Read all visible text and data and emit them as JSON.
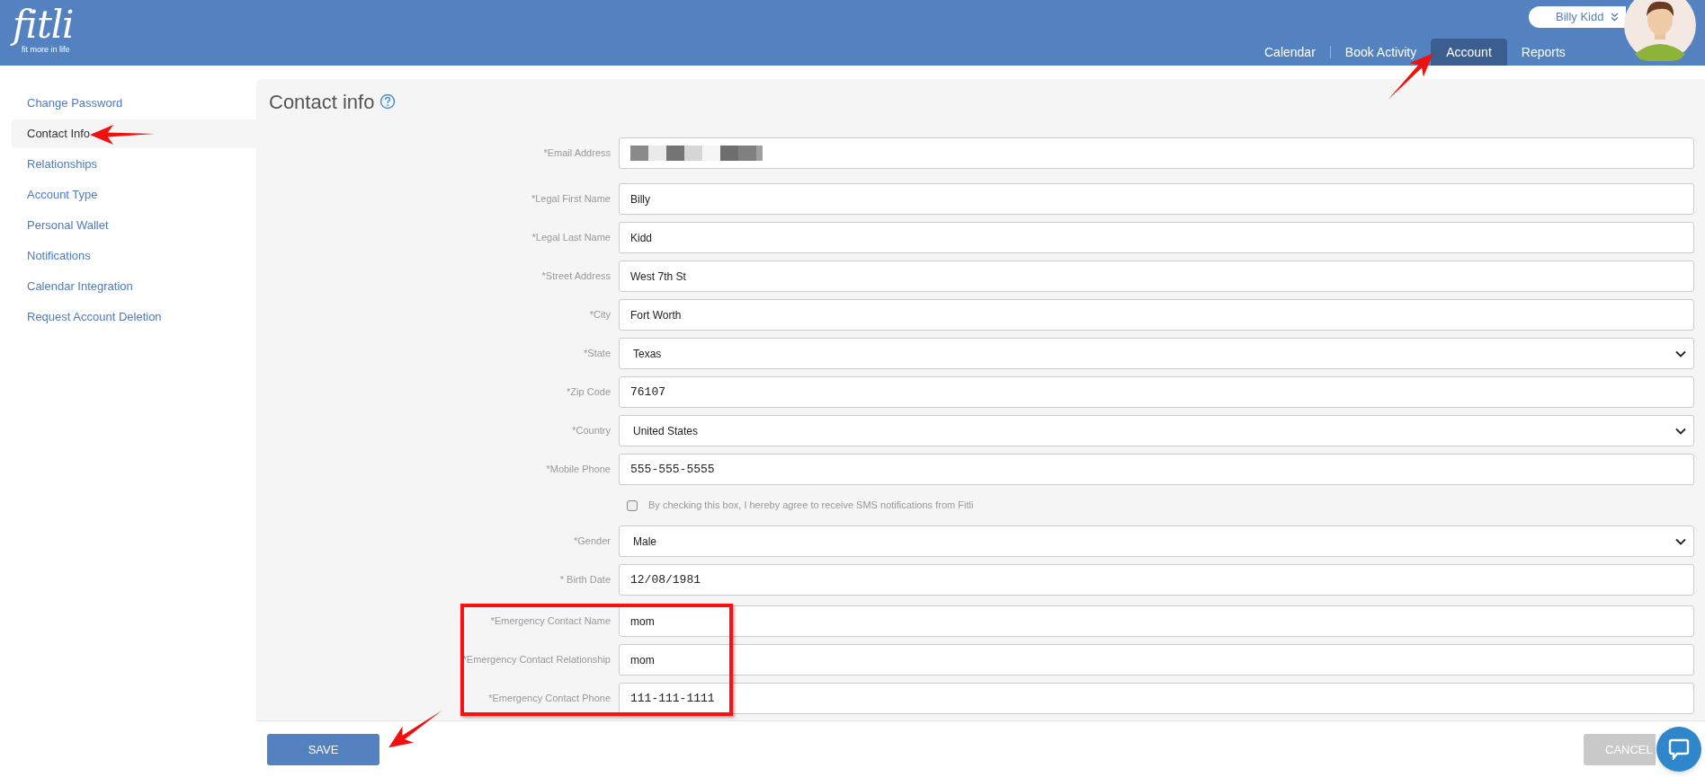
{
  "header": {
    "logo": "fitli",
    "tagline": "fit more in life",
    "user": {
      "name": "Billy Kidd"
    },
    "nav": [
      {
        "label": "Calendar",
        "selected": false
      },
      {
        "label": "Book Activity",
        "selected": false
      },
      {
        "label": "Account",
        "selected": true
      },
      {
        "label": "Reports",
        "selected": false
      }
    ]
  },
  "sidebar": {
    "items": [
      {
        "label": "Change Password",
        "selected": false
      },
      {
        "label": "Contact Info",
        "selected": true
      },
      {
        "label": "Relationships",
        "selected": false
      },
      {
        "label": "Account Type",
        "selected": false
      },
      {
        "label": "Personal Wallet",
        "selected": false
      },
      {
        "label": "Notifications",
        "selected": false
      },
      {
        "label": "Calendar Integration",
        "selected": false
      },
      {
        "label": "Request Account Deletion",
        "selected": false
      }
    ]
  },
  "form": {
    "title": "Contact info",
    "fields": [
      {
        "kind": "redacted",
        "label": "*Email Address"
      },
      {
        "kind": "text",
        "label": "*Legal First Name",
        "value": "Billy"
      },
      {
        "kind": "text",
        "label": "*Legal Last Name",
        "value": "Kidd"
      },
      {
        "kind": "text",
        "label": "*Street Address",
        "value": "West 7th St"
      },
      {
        "kind": "text",
        "label": "*City",
        "value": "Fort Worth"
      },
      {
        "kind": "select",
        "label": "*State",
        "value": "Texas"
      },
      {
        "kind": "numeric",
        "label": "*Zip Code",
        "value": "76107"
      },
      {
        "kind": "select",
        "label": "*Country",
        "value": "United States"
      },
      {
        "kind": "numeric",
        "label": "*Mobile Phone",
        "value": "555-555-5555"
      },
      {
        "kind": "checkbox",
        "label": "By checking this box, I hereby agree to receive SMS notifications from Fitli",
        "checked": false
      },
      {
        "kind": "select",
        "label": "*Gender",
        "value": "Male"
      },
      {
        "kind": "numeric",
        "label": "* Birth Date",
        "value": "12/08/1981"
      },
      {
        "kind": "text",
        "label": "*Emergency Contact Name",
        "value": "mom"
      },
      {
        "kind": "text",
        "label": "*Emergency Contact Relationship",
        "value": "mom"
      },
      {
        "kind": "numeric",
        "label": "*Emergency Contact Phone",
        "value": "111-111-1111"
      }
    ]
  },
  "buttons": {
    "save": "SAVE",
    "cancel": "CANCEL"
  }
}
